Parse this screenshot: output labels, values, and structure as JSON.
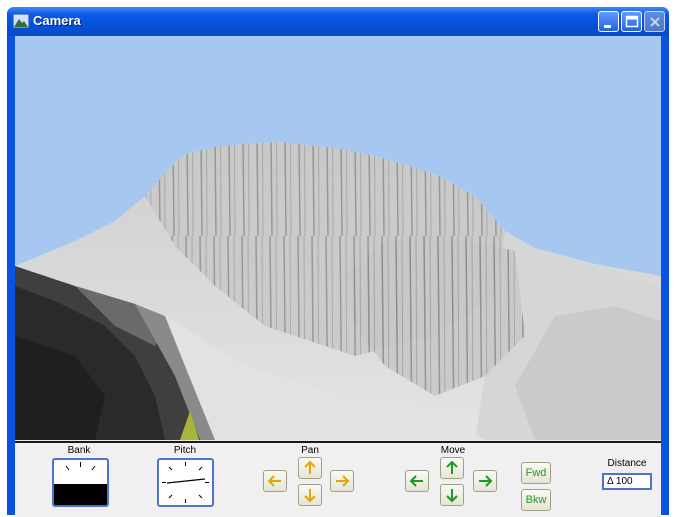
{
  "window": {
    "title": "Camera"
  },
  "controls": {
    "bank": {
      "label": "Bank"
    },
    "pitch": {
      "label": "Pitch"
    },
    "pan": {
      "label": "Pan"
    },
    "move": {
      "label": "Move"
    },
    "fwd_label": "Fwd",
    "bkw_label": "Bkw",
    "distance": {
      "label": "Distance",
      "value": "Δ 100"
    }
  },
  "icons": {
    "arrow_pan": "#e6a500",
    "arrow_move": "#1e9a20"
  }
}
